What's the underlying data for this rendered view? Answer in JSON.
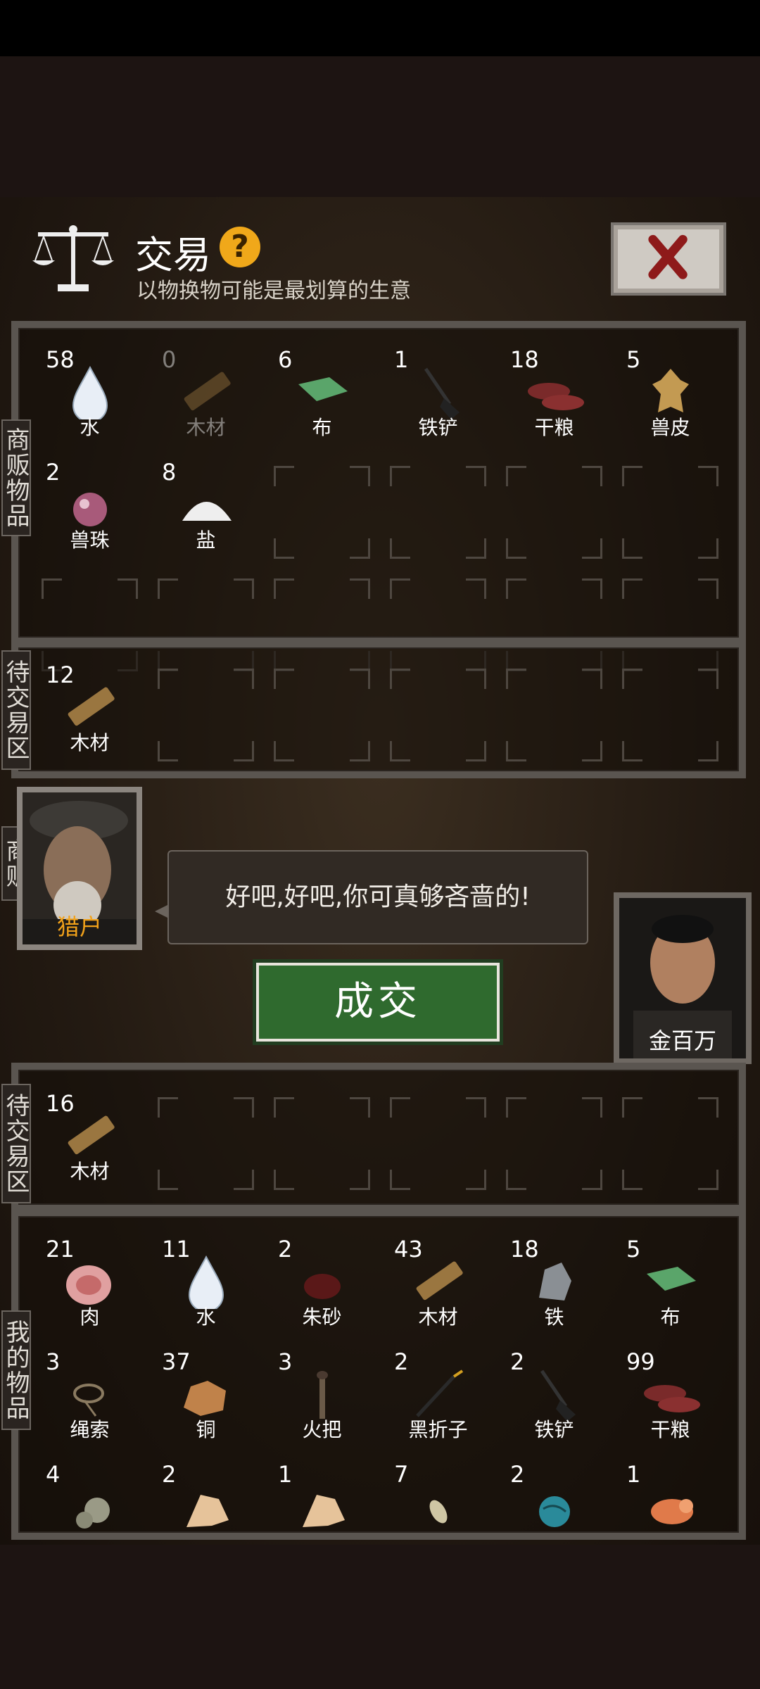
{
  "header": {
    "title": "交易",
    "help_symbol": "?",
    "subtitle": "以物换物可能是最划算的生意",
    "close_icon": "close-x-icon"
  },
  "merchant_items": {
    "label": "商贩物品",
    "items": [
      {
        "count": "58",
        "name": "水",
        "icon": "water-drop-icon"
      },
      {
        "count": "0",
        "name": "木材",
        "icon": "wood-plank-icon",
        "dimmed": true
      },
      {
        "count": "6",
        "name": "布",
        "icon": "cloth-icon"
      },
      {
        "count": "1",
        "name": "铁铲",
        "icon": "shovel-icon"
      },
      {
        "count": "18",
        "name": "干粮",
        "icon": "dried-meat-icon"
      },
      {
        "count": "5",
        "name": "兽皮",
        "icon": "animal-hide-icon"
      },
      {
        "count": "2",
        "name": "兽珠",
        "icon": "beast-pearl-icon"
      },
      {
        "count": "8",
        "name": "盐",
        "icon": "salt-icon"
      }
    ]
  },
  "merchant_pending": {
    "label": "待交易区",
    "items": [
      {
        "count": "12",
        "name": "木材",
        "icon": "wood-plank-icon"
      }
    ]
  },
  "merchant": {
    "label": "商贩",
    "name": "猎户",
    "dialog": "好吧,好吧,你可真够吝啬的!"
  },
  "deal_button": "成交",
  "player": {
    "name": "金百万"
  },
  "player_pending": {
    "label": "待交易区",
    "items": [
      {
        "count": "16",
        "name": "木材",
        "icon": "wood-plank-icon"
      }
    ]
  },
  "player_items": {
    "label": "我的物品",
    "items": [
      {
        "count": "21",
        "name": "肉",
        "icon": "meat-icon"
      },
      {
        "count": "11",
        "name": "水",
        "icon": "water-drop-icon"
      },
      {
        "count": "2",
        "name": "朱砂",
        "icon": "cinnabar-icon"
      },
      {
        "count": "43",
        "name": "木材",
        "icon": "wood-plank-icon"
      },
      {
        "count": "18",
        "name": "铁",
        "icon": "iron-ore-icon"
      },
      {
        "count": "5",
        "name": "布",
        "icon": "cloth-icon"
      },
      {
        "count": "3",
        "name": "绳索",
        "icon": "rope-icon"
      },
      {
        "count": "37",
        "name": "铜",
        "icon": "copper-ore-icon"
      },
      {
        "count": "3",
        "name": "火把",
        "icon": "torch-icon"
      },
      {
        "count": "2",
        "name": "黑折子",
        "icon": "pickaxe-icon"
      },
      {
        "count": "2",
        "name": "铁铲",
        "icon": "shovel-icon"
      },
      {
        "count": "99",
        "name": "干粮",
        "icon": "dried-meat-icon"
      },
      {
        "count": "4",
        "name": "",
        "icon": "gourd-icon"
      },
      {
        "count": "2",
        "name": "",
        "icon": "bone-fragment-icon"
      },
      {
        "count": "1",
        "name": "",
        "icon": "bone-fragment-icon"
      },
      {
        "count": "7",
        "name": "",
        "icon": "seed-icon"
      },
      {
        "count": "2",
        "name": "",
        "icon": "jade-orb-icon"
      },
      {
        "count": "1",
        "name": "",
        "icon": "amber-carving-icon"
      }
    ]
  }
}
